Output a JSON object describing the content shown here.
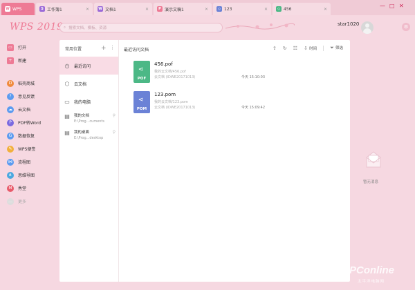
{
  "tabs": [
    {
      "label": "WPS",
      "active": true,
      "icon": "wps-icon",
      "color": "#ee7a95"
    },
    {
      "label": "工作簿1",
      "icon": "spreadsheet-icon",
      "color": "#9c6bd8"
    },
    {
      "label": "文档1",
      "icon": "document-icon",
      "color": "#9c6bd8"
    },
    {
      "label": "演示文稿1",
      "icon": "presentation-icon",
      "color": "#ee7a95"
    },
    {
      "label": "123",
      "icon": "pom-icon",
      "color": "#6b82d6"
    },
    {
      "label": "456",
      "icon": "pof-icon",
      "color": "#4cb886"
    }
  ],
  "header": {
    "logo": "WPS 2019",
    "search_placeholder": "搜索文档、模板、资源",
    "username": "star1020"
  },
  "nav": {
    "primary": [
      {
        "label": "打开",
        "icon": "folder-icon",
        "color": "#ee7a95"
      },
      {
        "label": "新建",
        "icon": "plus-icon",
        "color": "#ee7a95"
      }
    ],
    "apps": [
      {
        "label": "稻壳商城",
        "icon": "store-icon",
        "color": "#f08a3c"
      },
      {
        "label": "意见反馈",
        "icon": "feedback-icon",
        "color": "#5b9bf0"
      },
      {
        "label": "云文档",
        "icon": "cloud-icon",
        "color": "#5b9bf0"
      },
      {
        "label": "PDF转Word",
        "icon": "pdf-icon",
        "color": "#7a6ae0"
      },
      {
        "label": "数据恢复",
        "icon": "recover-icon",
        "color": "#5b9bf0"
      },
      {
        "label": "WPS便签",
        "icon": "note-icon",
        "color": "#f2b03c"
      },
      {
        "label": "流程图",
        "icon": "flowchart-icon",
        "color": "#5b9bf0"
      },
      {
        "label": "思维导图",
        "icon": "mindmap-icon",
        "color": "#4aa8e0"
      },
      {
        "label": "秀堂",
        "icon": "show-icon",
        "color": "#e85a6a"
      },
      {
        "label": "更多",
        "icon": "more-icon",
        "color": "#dddddd"
      }
    ]
  },
  "locations": {
    "title": "常用位置",
    "items": [
      {
        "label": "最近访问",
        "icon": "clock-icon",
        "active": true
      },
      {
        "label": "云文档",
        "icon": "cloud-icon"
      },
      {
        "label": "我的电脑",
        "icon": "computer-icon"
      }
    ],
    "folders": [
      {
        "name": "我的文档",
        "path": "E:\\Prog...cuments"
      },
      {
        "name": "我的桌面",
        "path": "E:\\Prog...desktop"
      }
    ]
  },
  "files": {
    "title": "最近访问文档",
    "toolbar": {
      "time_label": "时间",
      "filter_label": "筛选"
    },
    "items": [
      {
        "name": "456.pof",
        "path": "我的云文档/456.pof",
        "owner": "云文档 (IDWE20171013)",
        "time": "今天 15:10:03",
        "type": "POF",
        "color": "#4cb886"
      },
      {
        "name": "123.pom",
        "path": "我的云文档/123.pom",
        "owner": "云文档 (IDWE20171013)",
        "time": "今天 15:09:42",
        "type": "POM",
        "color": "#6b82d6"
      }
    ]
  },
  "notice": {
    "text": "暂无消息"
  },
  "watermark": {
    "brand": "PConline",
    "sub": "太平洋电脑网"
  }
}
